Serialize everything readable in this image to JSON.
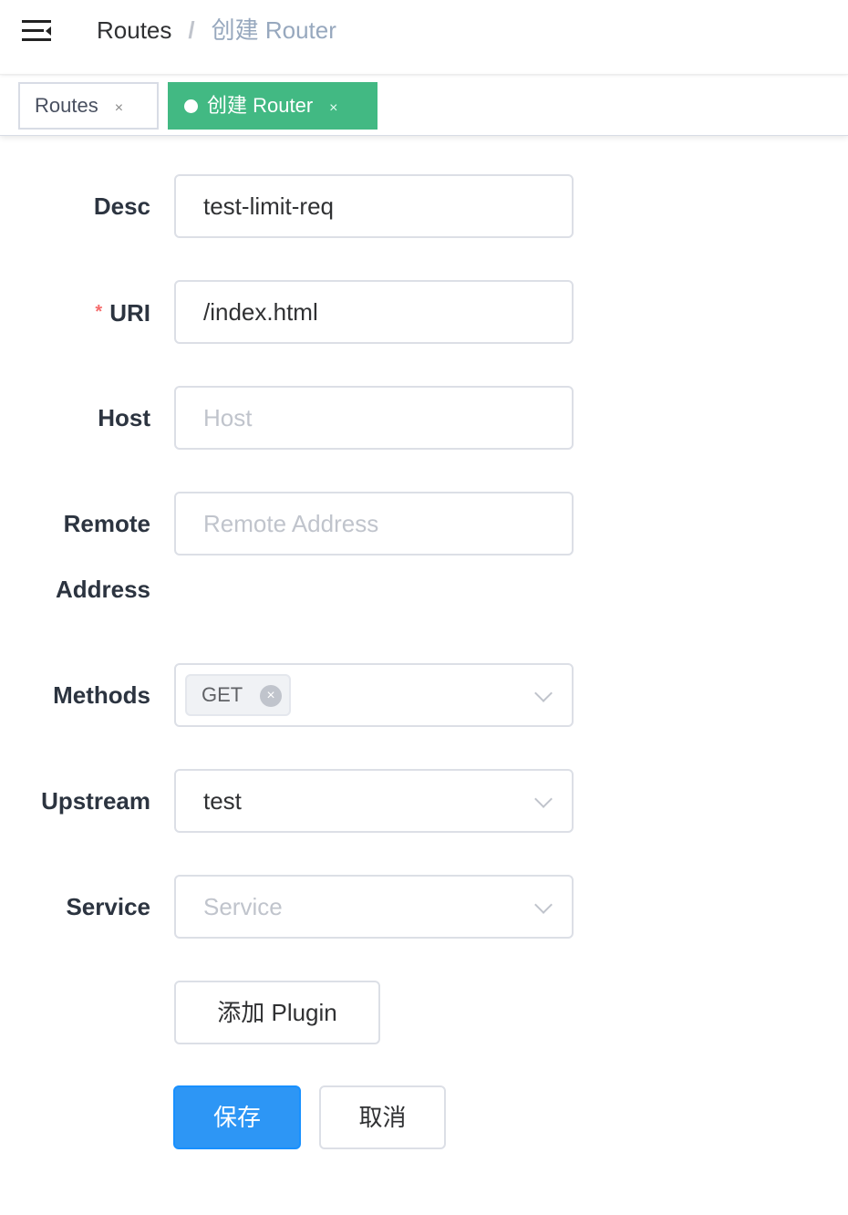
{
  "header": {
    "breadcrumb": [
      "Routes",
      "/",
      "创建 Router"
    ]
  },
  "tags": [
    {
      "label": "Routes",
      "close": "×"
    },
    {
      "label": "创建 Router",
      "close": "×",
      "active": true
    }
  ],
  "form": {
    "desc": {
      "label": "Desc",
      "value": "test-limit-req"
    },
    "uri": {
      "label": "URI",
      "required": "*",
      "value": "/index.html"
    },
    "host": {
      "label": "Host",
      "placeholder": "Host"
    },
    "remote": {
      "label1": "Remote",
      "label2": "Address",
      "placeholder": "Remote Address"
    },
    "methods": {
      "label": "Methods",
      "selected": "GET",
      "chip_close": "×"
    },
    "upstream": {
      "label": "Upstream",
      "value": "test"
    },
    "service": {
      "label": "Service",
      "placeholder": "Service"
    },
    "add_plugin": "添加 Plugin",
    "save": "保存",
    "cancel": "取消"
  },
  "colors": {
    "active_tag": "#42b983",
    "primary": "#2d96f5",
    "required": "#f56c6c"
  }
}
